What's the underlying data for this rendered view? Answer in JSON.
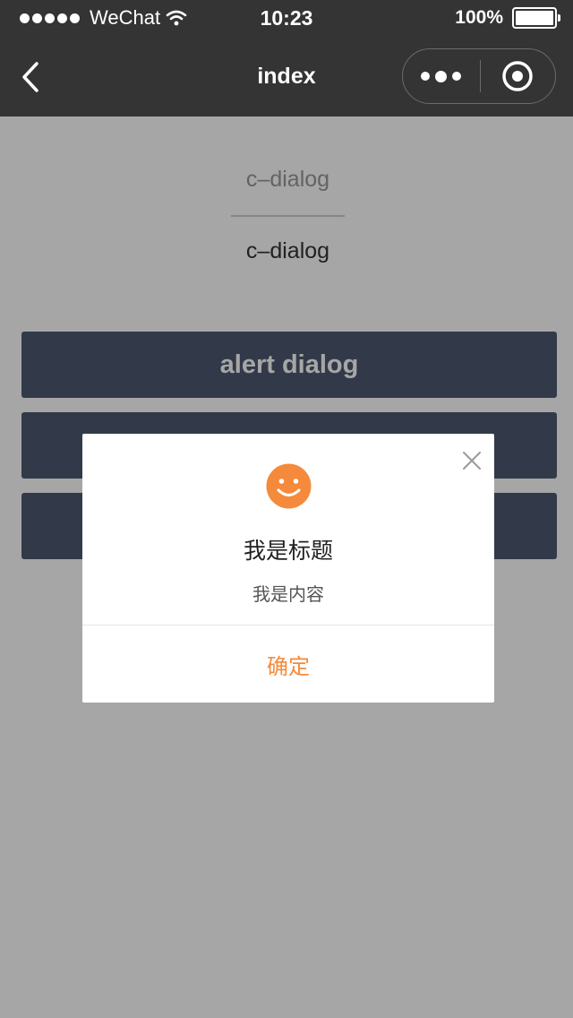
{
  "status_bar": {
    "carrier": "WeChat",
    "time": "10:23",
    "battery_text": "100%"
  },
  "nav": {
    "title": "index",
    "icons": {
      "back": "chevron-left-icon",
      "more": "more-dots-icon",
      "close": "record-circle-icon"
    }
  },
  "page": {
    "field_1": "c–dialog",
    "field_2": "c–dialog",
    "buttons": [
      {
        "label": "alert dialog"
      },
      {
        "label": ""
      },
      {
        "label": ""
      }
    ]
  },
  "dialog": {
    "icon": "smile-icon",
    "title": "我是标题",
    "content": "我是内容",
    "confirm_label": "确定"
  },
  "colors": {
    "bar_background": "#343434",
    "button_background": "#4d5a70",
    "accent": "#f58a3c",
    "mask": "rgba(0,0,0,0.35)"
  }
}
